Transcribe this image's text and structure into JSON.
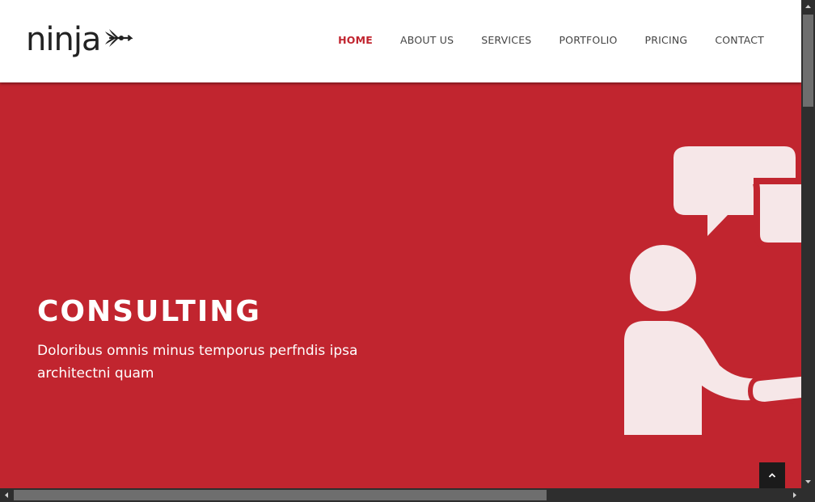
{
  "brand": {
    "logo_text": "ninja",
    "logo_mark": "arrow-fletching-icon"
  },
  "nav": {
    "items": [
      {
        "label": "HOME",
        "active": true
      },
      {
        "label": "ABOUT US",
        "active": false
      },
      {
        "label": "SERVICES",
        "active": false
      },
      {
        "label": "PORTFOLIO",
        "active": false
      },
      {
        "label": "PRICING",
        "active": false
      },
      {
        "label": "CONTACT",
        "active": false
      }
    ]
  },
  "hero": {
    "title": "CONSULTING",
    "subtitle": "Doloribus omnis minus temporus perfndis ipsa architectni quam",
    "illustration": "consulting-people-speech-bubbles-icon",
    "background_color": "#c1252f"
  },
  "scroll_to_top": {
    "icon": "chevron-up-icon"
  },
  "colors": {
    "accent": "#c1252f",
    "nav_text": "#444444",
    "illustration_fill": "#f6e7e8"
  }
}
